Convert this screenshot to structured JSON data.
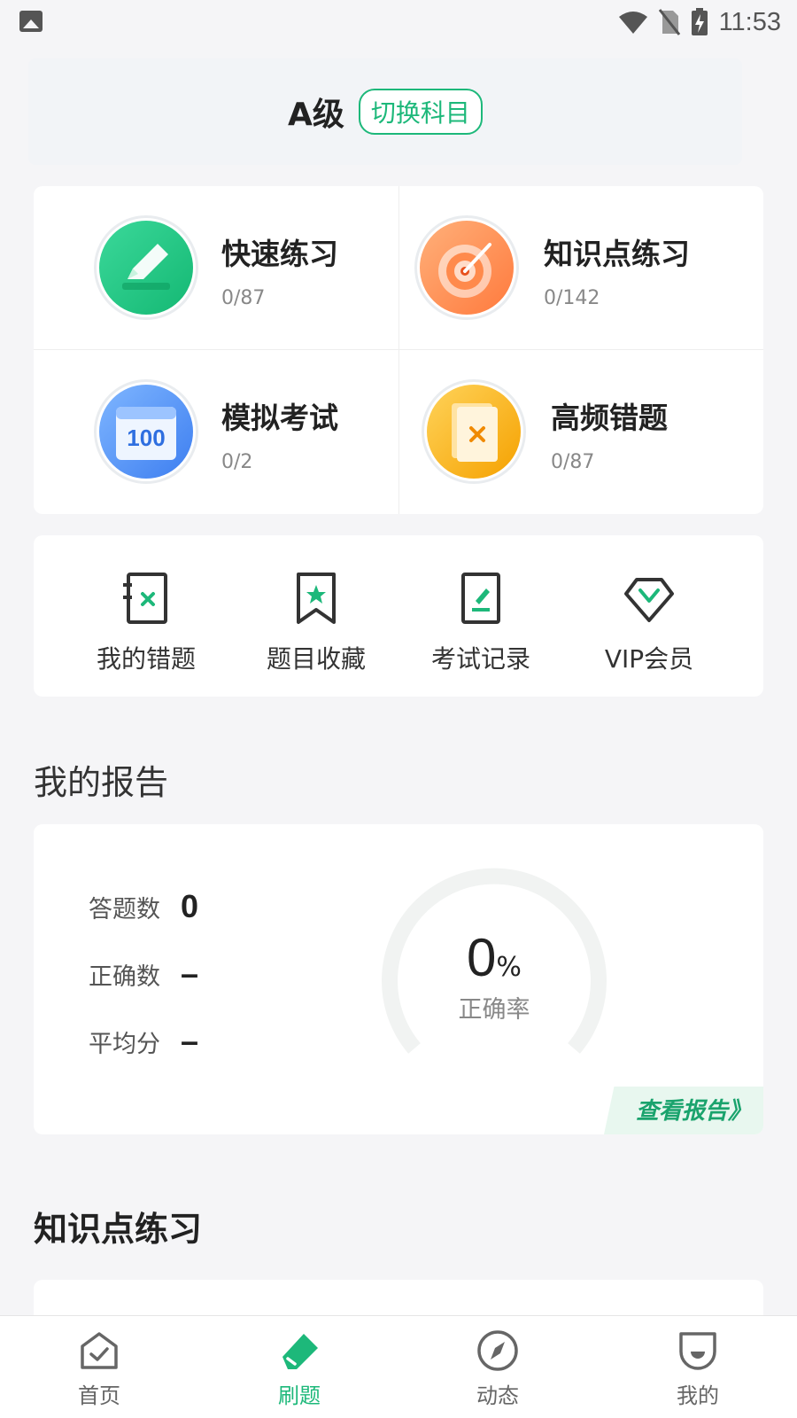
{
  "status_bar": {
    "time": "11:53"
  },
  "subject": {
    "name": "A级",
    "switch_label": "切换科目"
  },
  "practice": [
    {
      "title": "快速练习",
      "count": "0/87",
      "icon": "pencil-icon"
    },
    {
      "title": "知识点练习",
      "count": "0/142",
      "icon": "target-icon"
    },
    {
      "title": "模拟考试",
      "count": "0/2",
      "icon": "calendar-100-icon",
      "icon_text": "100"
    },
    {
      "title": "高频错题",
      "count": "0/87",
      "icon": "book-x-icon"
    }
  ],
  "tools": [
    {
      "label": "我的错题",
      "icon": "wrong-note-icon"
    },
    {
      "label": "题目收藏",
      "icon": "bookmark-star-icon"
    },
    {
      "label": "考试记录",
      "icon": "exam-record-icon"
    },
    {
      "label": "VIP会员",
      "icon": "diamond-v-icon"
    }
  ],
  "report": {
    "section_title": "我的报告",
    "stats": [
      {
        "label": "答题数",
        "value": "0"
      },
      {
        "label": "正确数",
        "value": "–"
      },
      {
        "label": "平均分",
        "value": "–"
      }
    ],
    "accuracy_value": "0",
    "accuracy_unit": "%",
    "accuracy_label": "正确率",
    "view_report": "查看报告》"
  },
  "knowledge_section_title": "知识点练习",
  "tabs": [
    {
      "label": "首页",
      "icon": "home-check-icon",
      "active": false
    },
    {
      "label": "刷题",
      "icon": "eraser-icon",
      "active": true
    },
    {
      "label": "动态",
      "icon": "compass-icon",
      "active": false
    },
    {
      "label": "我的",
      "icon": "profile-icon",
      "active": false
    }
  ],
  "colors": {
    "accent": "#1db87a",
    "background": "#f5f5f7"
  }
}
